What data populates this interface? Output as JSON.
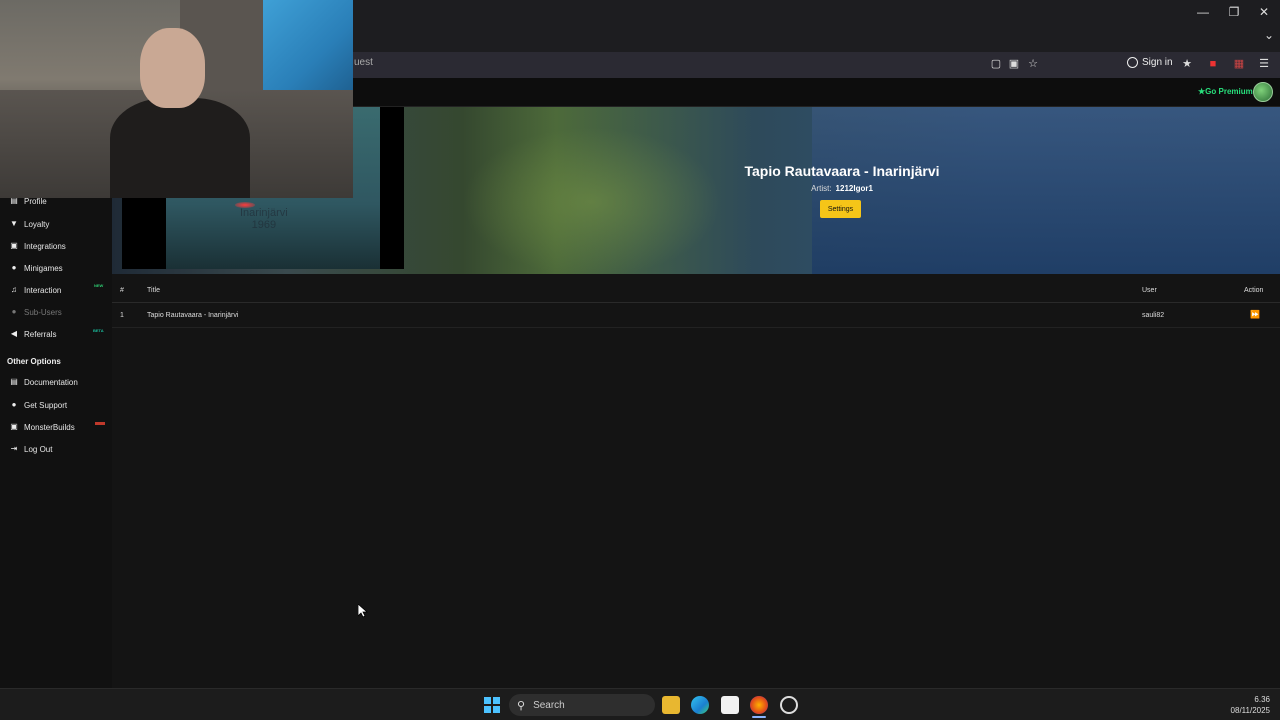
{
  "browser": {
    "url_fragment": "uest",
    "signin_label": "Sign in"
  },
  "site": {
    "premium_label": "Go Premium"
  },
  "sidebar": {
    "items": [
      {
        "label": "Profile",
        "icon": "profile-icon"
      },
      {
        "label": "Loyalty",
        "icon": "trophy-icon"
      },
      {
        "label": "Integrations",
        "icon": "plug-icon"
      },
      {
        "label": "Minigames",
        "icon": "gamepad-icon"
      },
      {
        "label": "Interaction",
        "icon": "music-icon",
        "badge": "NEW",
        "badge_color": "#2ecc71"
      },
      {
        "label": "Sub-Users",
        "icon": "users-icon",
        "dim": true
      },
      {
        "label": "Referrals",
        "icon": "megaphone-icon",
        "badge": "BETA",
        "badge_color": "#1abc9c"
      }
    ],
    "other_title": "Other Options",
    "other_items": [
      {
        "label": "Documentation",
        "icon": "book-icon"
      },
      {
        "label": "Get Support",
        "icon": "help-icon"
      },
      {
        "label": "MonsterBuilds",
        "icon": "laptop-icon",
        "badge_color": "#c0392b"
      },
      {
        "label": "Log Out",
        "icon": "logout-icon"
      }
    ]
  },
  "hero": {
    "song_title": "Tapio Rautavaara - Inarinjärvi",
    "artist_label": "Artist:",
    "artist_name": "1212Igor1",
    "settings_label": "Settings",
    "cover_text_line1": "Inarinjärvi",
    "cover_text_line2": "1969"
  },
  "table": {
    "headers": {
      "num": "#",
      "title": "Title",
      "user": "User",
      "action": "Action"
    },
    "rows": [
      {
        "num": "1",
        "title": "Tapio Rautavaara - Inarinjärvi",
        "user": "sauli82"
      }
    ]
  },
  "taskbar": {
    "search_label": "Search",
    "time": "6.36",
    "date": "08/11/2025"
  },
  "colors": {
    "accent_yellow": "#f5c518",
    "premium_green": "#28e07c"
  }
}
